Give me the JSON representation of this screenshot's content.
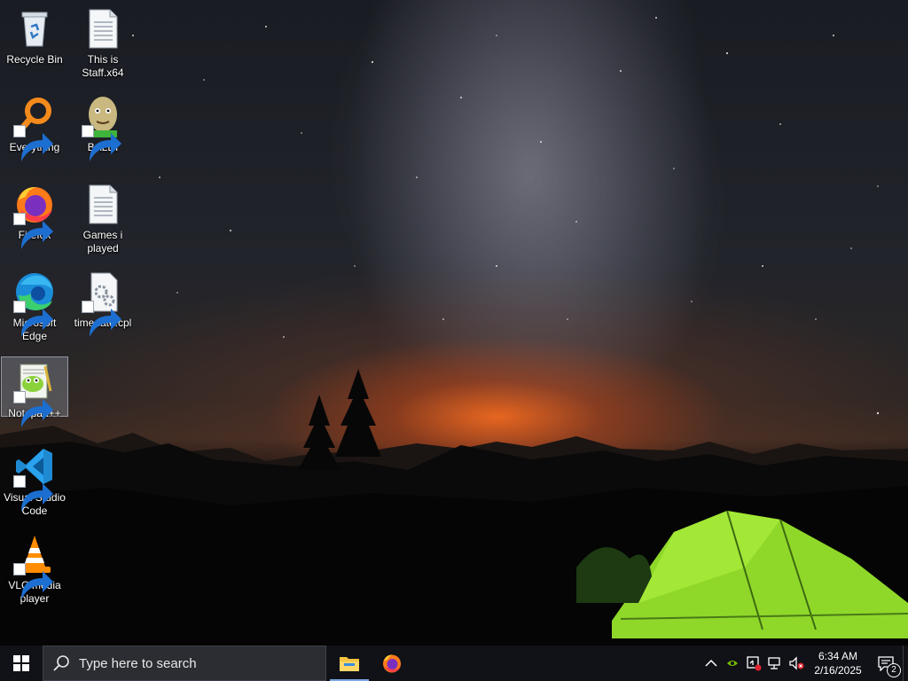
{
  "desktop": {
    "icons": [
      {
        "label": "Recycle Bin",
        "icon": "recycle-bin-icon",
        "shortcut": false
      },
      {
        "label": "This is Staff.x64",
        "icon": "text-file-icon",
        "shortcut": false
      },
      {
        "label": "Everything",
        "icon": "everything-search-icon",
        "shortcut": true
      },
      {
        "label": "BALDI",
        "icon": "baldi-game-icon",
        "shortcut": true
      },
      {
        "label": "Firefox",
        "icon": "firefox-icon",
        "shortcut": true
      },
      {
        "label": "Games i played",
        "icon": "text-file-icon",
        "shortcut": false
      },
      {
        "label": "Microsoft Edge",
        "icon": "edge-icon",
        "shortcut": true
      },
      {
        "label": "timedate.cpl",
        "icon": "control-panel-file-icon",
        "shortcut": true
      },
      {
        "label": "Notepad++",
        "icon": "notepad-plus-plus-icon",
        "shortcut": true,
        "selected": true
      },
      {
        "label": "Visual Studio Code",
        "icon": "vscode-icon",
        "shortcut": true
      },
      {
        "label": "VLC media player",
        "icon": "vlc-icon",
        "shortcut": true
      }
    ]
  },
  "taskbar": {
    "search_placeholder": "Type here to search",
    "pinned": [
      {
        "name": "File Explorer",
        "icon": "file-explorer-icon",
        "active": true
      },
      {
        "name": "Firefox",
        "icon": "firefox-icon",
        "active": false
      }
    ],
    "tray": {
      "icons": [
        "chevron-up-icon",
        "nvidia-icon",
        "security-alert-icon",
        "network-icon",
        "volume-muted-icon"
      ],
      "time": "6:34 AM",
      "date": "2/16/2025",
      "notification_count": "2"
    }
  },
  "colors": {
    "taskbar_bg": "#101217",
    "search_bg": "#2b2d33",
    "active_indicator": "#7aa9e6"
  }
}
